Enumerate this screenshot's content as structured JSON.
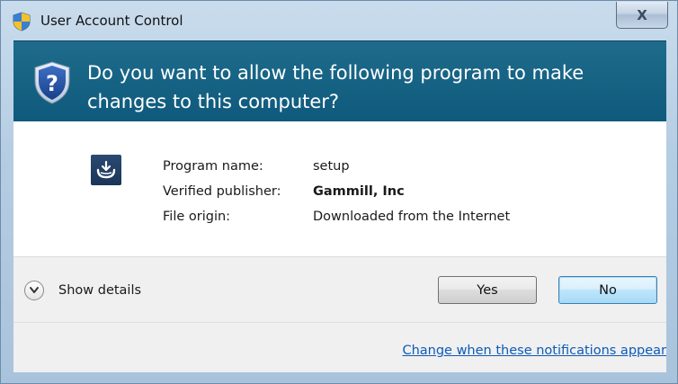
{
  "window": {
    "title": "User Account Control",
    "close_label": "X"
  },
  "header": {
    "question": "Do you want to allow the following program to make changes to this computer?"
  },
  "program": {
    "rows": [
      {
        "label": "Program name:",
        "value": "setup",
        "bold": false
      },
      {
        "label": "Verified publisher:",
        "value": "Gammill, Inc",
        "bold": true
      },
      {
        "label": "File origin:",
        "value": "Downloaded from the Internet",
        "bold": false
      }
    ]
  },
  "footer": {
    "details_label": "Show details",
    "yes_label": "Yes",
    "no_label": "No",
    "notifications_link": "Change when these notifications appear"
  },
  "colors": {
    "header_band": "#0f5a7c",
    "link": "#0d5bb8",
    "no_button_border": "#3c7fb1"
  },
  "icons": {
    "title": "uac-shield-icon",
    "header": "question-shield-icon",
    "program": "setup-program-icon",
    "details": "chevron-down-icon"
  }
}
